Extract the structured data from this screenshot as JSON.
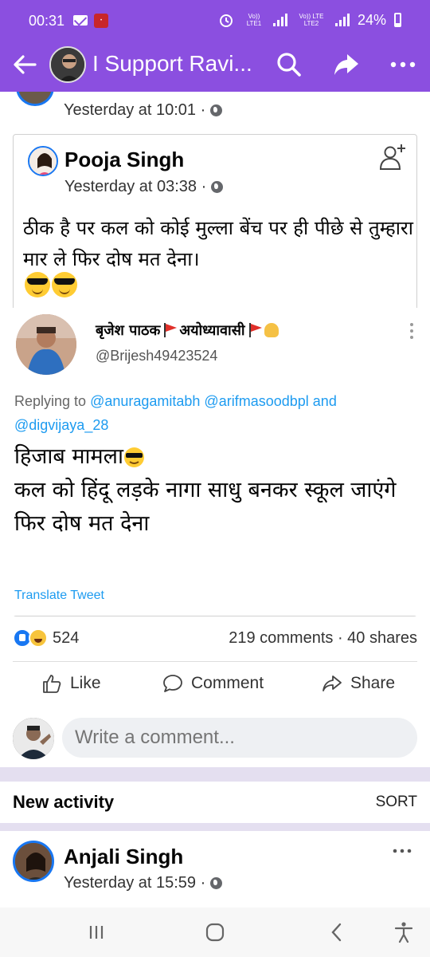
{
  "status_bar": {
    "time": "00:31",
    "network1": "Vo)) LTE1",
    "network2": "Vo)) LTE LTE2",
    "battery": "24%"
  },
  "header": {
    "title": "I Support Ravi...",
    "icons": [
      "back-arrow-icon",
      "search-icon",
      "share-icon",
      "more-icon"
    ],
    "bg_color": "#8b4fe0"
  },
  "top_post": {
    "time": "Yesterday at 10:01 ·"
  },
  "shared_post": {
    "author": "Pooja Singh",
    "time": "Yesterday at 03:38 ·",
    "text": "ठीक है पर कल को कोई मुल्ला बेंच पर ही पीछे से तुम्हारा मार ले फिर दोष मत देना।"
  },
  "tweet": {
    "name": "बृजेश पाठक",
    "name_suffix": "अयोध्यावासी",
    "handle": "@Brijesh49423524",
    "replying_prefix": "Replying to",
    "replying_to": "@anuragamitabh @arifmasoodbpl",
    "replying_and": "and",
    "replying_to2": "@digvijaya_28",
    "line1": "हिजाब मामला",
    "line2": "कल को हिंदू लड़के नागा साधु बनकर स्कूल जाएंगे",
    "line3": "फिर दोष मत देना",
    "translate": "Translate Tweet"
  },
  "stats": {
    "reactions_count": "524",
    "comments_shares": "219 comments · 40 shares"
  },
  "actions": {
    "like": "Like",
    "comment": "Comment",
    "share": "Share"
  },
  "comment_box": {
    "placeholder": "Write a comment..."
  },
  "activity": {
    "title": "New activity",
    "sort": "SORT"
  },
  "next_post": {
    "author": "Anjali Singh",
    "time": "Yesterday at 15:59 ·"
  }
}
